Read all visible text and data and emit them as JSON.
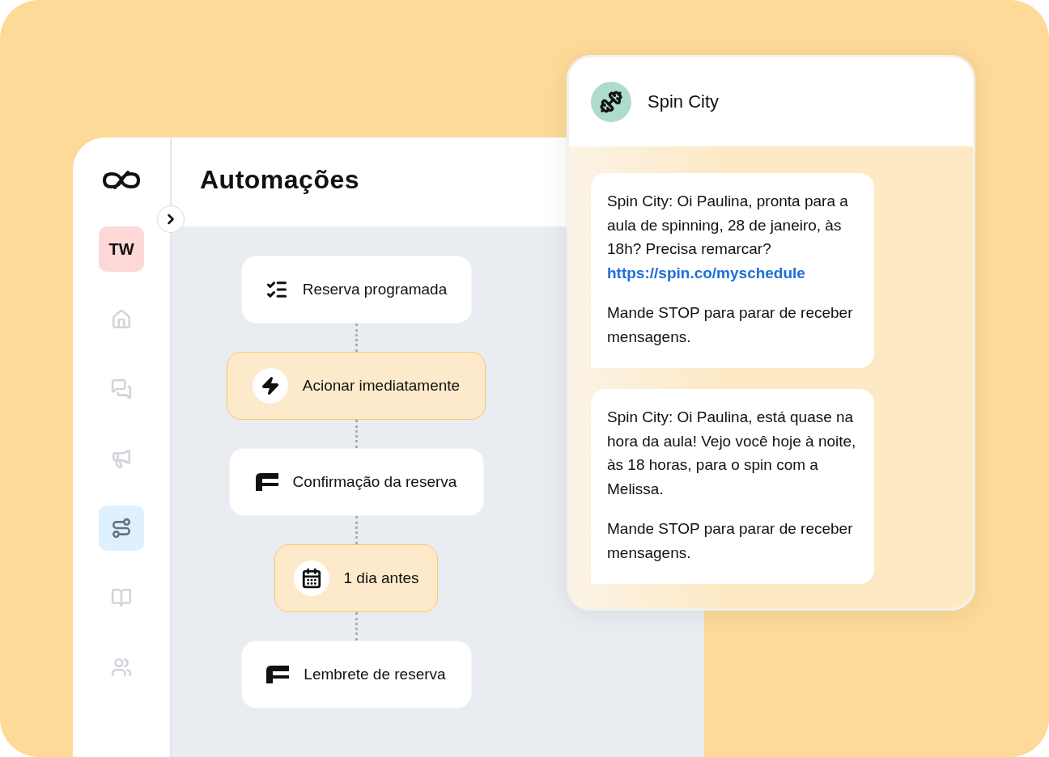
{
  "sidebar": {
    "avatar": "TW",
    "items": [
      {
        "kind": "home",
        "selected": false
      },
      {
        "kind": "chat",
        "selected": false
      },
      {
        "kind": "megaphone",
        "selected": false
      },
      {
        "kind": "flow",
        "selected": true
      },
      {
        "kind": "book",
        "selected": false
      },
      {
        "kind": "people",
        "selected": false
      }
    ]
  },
  "header": {
    "title": "Automações"
  },
  "flow": {
    "nodes": [
      {
        "kind": "event",
        "label": "Reserva programada"
      },
      {
        "kind": "trigger",
        "label": "Acionar imediatamente"
      },
      {
        "kind": "message",
        "label": "Confirmação da reserva"
      },
      {
        "kind": "delay",
        "label": "1 dia antes"
      },
      {
        "kind": "message",
        "label": "Lembrete de reserva"
      }
    ]
  },
  "chat": {
    "name": "Spin City",
    "messages": [
      {
        "body": "Spin City: Oi Paulina, pronta para a aula de spinning, 28 de janeiro, às 18h? Precisa remarcar?",
        "link": "https://spin.co/myschedule",
        "footer": "Mande STOP para parar de receber mensagens."
      },
      {
        "body": "Spin City: Oi Paulina, está quase na hora da aula! Vejo você hoje à noite, às 18 horas, para o spin com a Melissa.",
        "footer": "Mande STOP para parar de receber mensagens."
      }
    ]
  }
}
